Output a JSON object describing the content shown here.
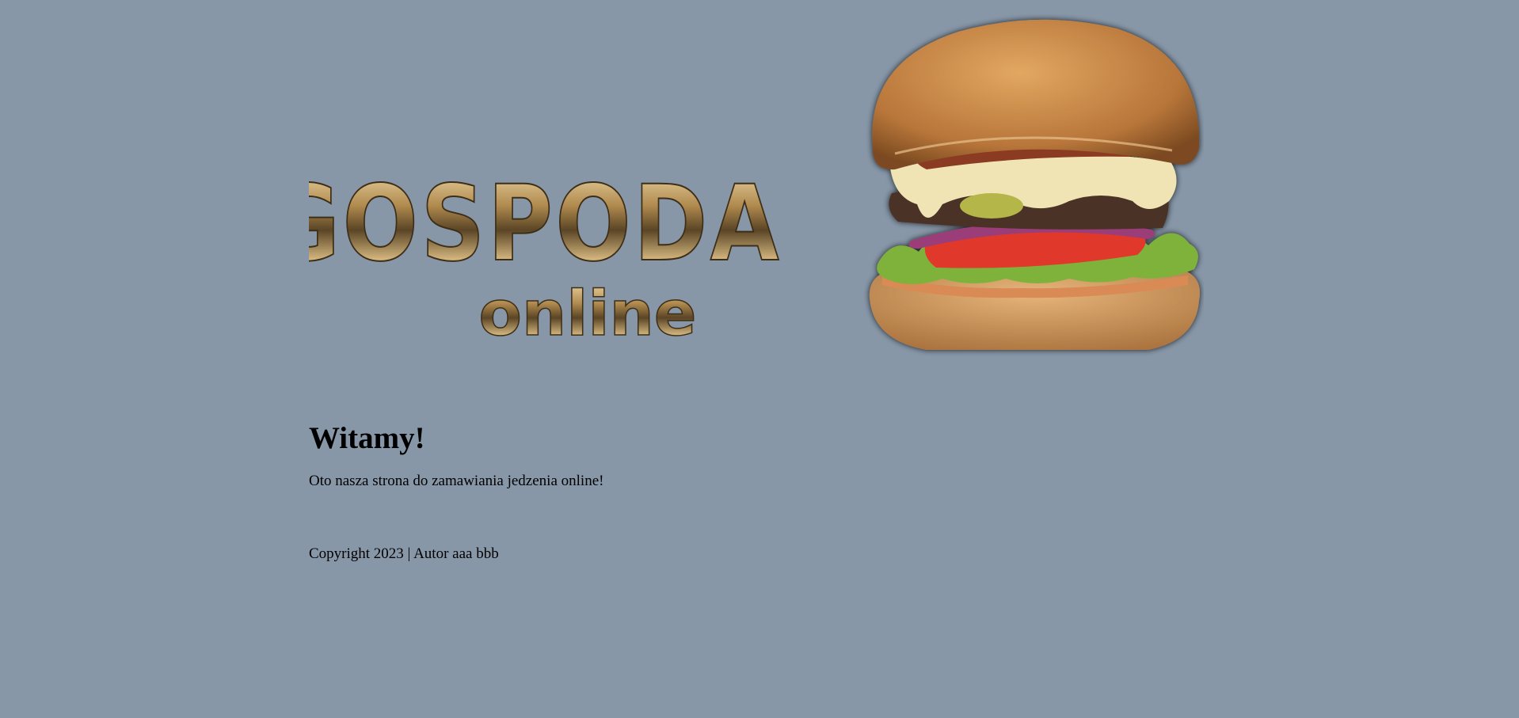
{
  "header": {
    "logo_text": "GOSPODA",
    "logo_subtext": "online",
    "hero_image": "burger-image"
  },
  "main": {
    "heading": "Witamy!",
    "paragraph": "Oto nasza strona do zamawiania jedzenia online!"
  },
  "footer": {
    "copyright": "Copyright 2023 | Autor aaa bbb"
  },
  "colors": {
    "background": "#8797a8",
    "logo_gold": "#c9a46a",
    "text": "#000000"
  }
}
